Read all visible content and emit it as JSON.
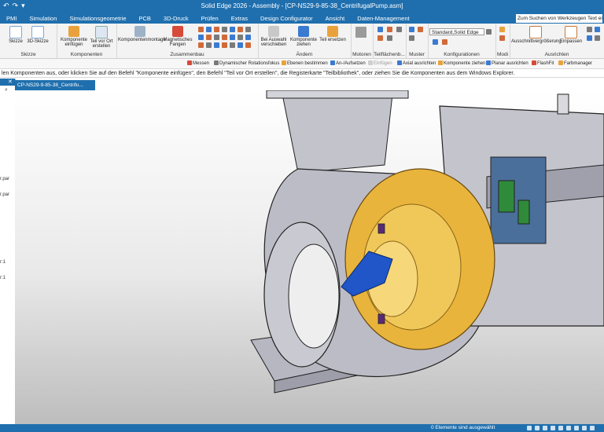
{
  "window": {
    "title": "Solid Edge 2026 - Assembly - [CP-NS29-9-85-38_CentrifugalPump.asm]"
  },
  "quick_access": {
    "undo": "↶",
    "redo": "↷",
    "more": "▾"
  },
  "menu": {
    "tabs": [
      "PMI",
      "Simulation",
      "Simulationsgeometrie",
      "PCB",
      "3D-Druck",
      "Prüfen",
      "Extras",
      "Design Configurator",
      "Ansicht",
      "Daten-Management"
    ],
    "search_placeholder": "Zum Suchen von Werkzeugen Text einge"
  },
  "ribbon": {
    "skizze": {
      "label": "Skizze",
      "items": [
        "Skizze",
        "3D-Skizze"
      ]
    },
    "komponenten": {
      "label": "Komponenten",
      "items": [
        "Komponente einfügen",
        "Teil vor Ort erstellen"
      ]
    },
    "zusammenbau": {
      "label": "Zusammenbau",
      "items": [
        "Komponentenmontage",
        "Magnetisches Fangen"
      ]
    },
    "aendern": {
      "label": "Ändern",
      "items": [
        "Bei Auswahl verschieben",
        "Komponente ziehen",
        "Teil ersetzen"
      ]
    },
    "motoren": {
      "label": "Motoren"
    },
    "teilflaechen": {
      "label": "Teilflächenb..."
    },
    "muster": {
      "label": "Muster"
    },
    "konfigurationen": {
      "label": "Konfigurationen",
      "select": "Standard,Solid Edge"
    },
    "modi": {
      "label": "Modi"
    },
    "ausrichten": {
      "label": "Ausrichten",
      "items": [
        "Ausschnittvergrößerung",
        "Einpassen"
      ]
    }
  },
  "command_bar": [
    "Messen",
    "Dynamischer Rotationsfokus",
    "Ebenen bestimmen",
    "An-/Aufsetzen",
    "Einfügen",
    "Axial ausrichten",
    "Komponente ziehen",
    "Planar ausrichten",
    "FlashFit",
    "Farbmanager"
  ],
  "prompt": "len Komponenten aus, oder klicken Sie auf den Befehl \"Komponente einfügen\", den Befehl \"Teil vor Ort erstellen\", die Registerkarte \"Teilbibliothek\", oder ziehen Sie die Komponenten aus dem Windows Explorer.",
  "left_pane": {
    "fragments": [
      "r.par",
      "r.par",
      "r:1",
      "r:1"
    ]
  },
  "document_tab": "CP-NS29-9-85-38_Centrifu...",
  "status": {
    "text": "0 Elemente sind ausgewählt"
  },
  "colors": {
    "accent": "#1f6fae",
    "impeller": "#e8b43c",
    "casing": "#b9b9c4",
    "blue_part": "#2156c9"
  }
}
